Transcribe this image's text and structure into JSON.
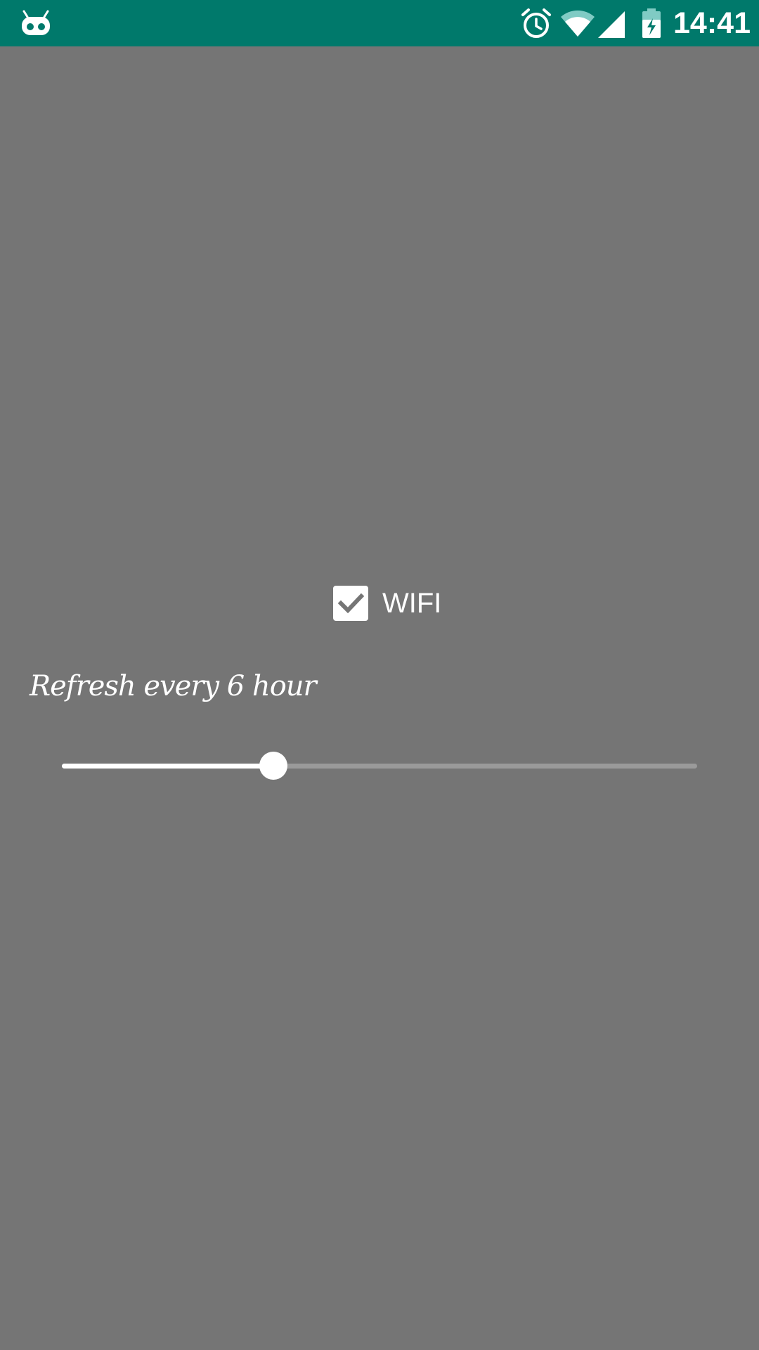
{
  "status_bar": {
    "time": "14:41",
    "background": "#00796b",
    "icons": [
      "cyanogen-mod-icon",
      "alarm-icon",
      "wifi-icon",
      "cell-signal-icon",
      "battery-charging-icon"
    ]
  },
  "settings": {
    "wifi_checkbox": {
      "label": "WIFI",
      "checked": true
    },
    "refresh_label": "Refresh every 6 hour",
    "refresh_slider": {
      "value_fraction": 0.333
    }
  },
  "colors": {
    "background": "#757575",
    "accent": "#ffffff",
    "slider_inactive": "#9a9a9a"
  }
}
